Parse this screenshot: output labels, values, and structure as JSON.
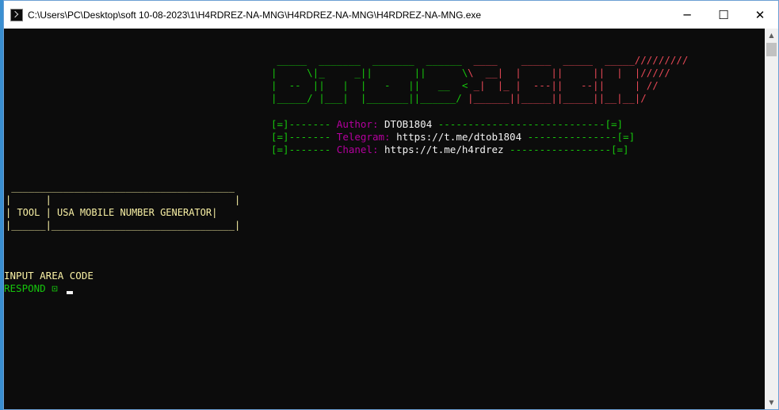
{
  "window": {
    "title": "C:\\Users\\PC\\Desktop\\soft 10-08-2023\\1\\H4RDREZ-NA-MNG\\H4RDREZ-NA-MNG\\H4RDREZ-NA-MNG.exe",
    "minimize_glyph": "─",
    "maximize_glyph": "☐",
    "close_glyph": "✕"
  },
  "banner": {
    "dtob_lines": [
      " _____  _______  _______  ______ ",
      "|     \\|_     _||       ||      \\",
      "|  --  ||   |  |   -   ||   __  <",
      "|_____/ |___|  |_______||______/ "
    ],
    "tech_lines": [
      " ____    _____  _____  _____/////////",
      "\\  __|  |     ||     ||  |  |/////",
      " _|  |_ |  ---||   --||     | //",
      "|______||_____||_____||__|__|/"
    ]
  },
  "info": [
    {
      "prefix": "[=]------- ",
      "label": "Author: ",
      "value": "DTOB1804",
      "suffix": " ----------------------------[=]"
    },
    {
      "prefix": "[=]------- ",
      "label": "Telegram: ",
      "value": "https://t.me/dtob1804",
      "suffix": " ---------------[=]"
    },
    {
      "prefix": "[=]------- ",
      "label": "Chanel: ",
      "value": "https://t.me/h4rdrez",
      "suffix": " -----------------[=]"
    }
  ],
  "tool_box": {
    "top": " _______________________________________",
    "mid_blank": "|      |                                |",
    "row": "| TOOL | USA MOBILE NUMBER GENERATOR|",
    "bottom": "|______|________________________________|"
  },
  "prompt": {
    "input_label": "INPUT AREA CODE",
    "respond_label": "RESPOND ",
    "respond_glyph": "⊡"
  },
  "colors": {
    "green": "#16c60c",
    "red": "#e74856",
    "magenta": "#b4009e",
    "yellow": "#f9f1a5",
    "white": "#f2f2f2"
  }
}
